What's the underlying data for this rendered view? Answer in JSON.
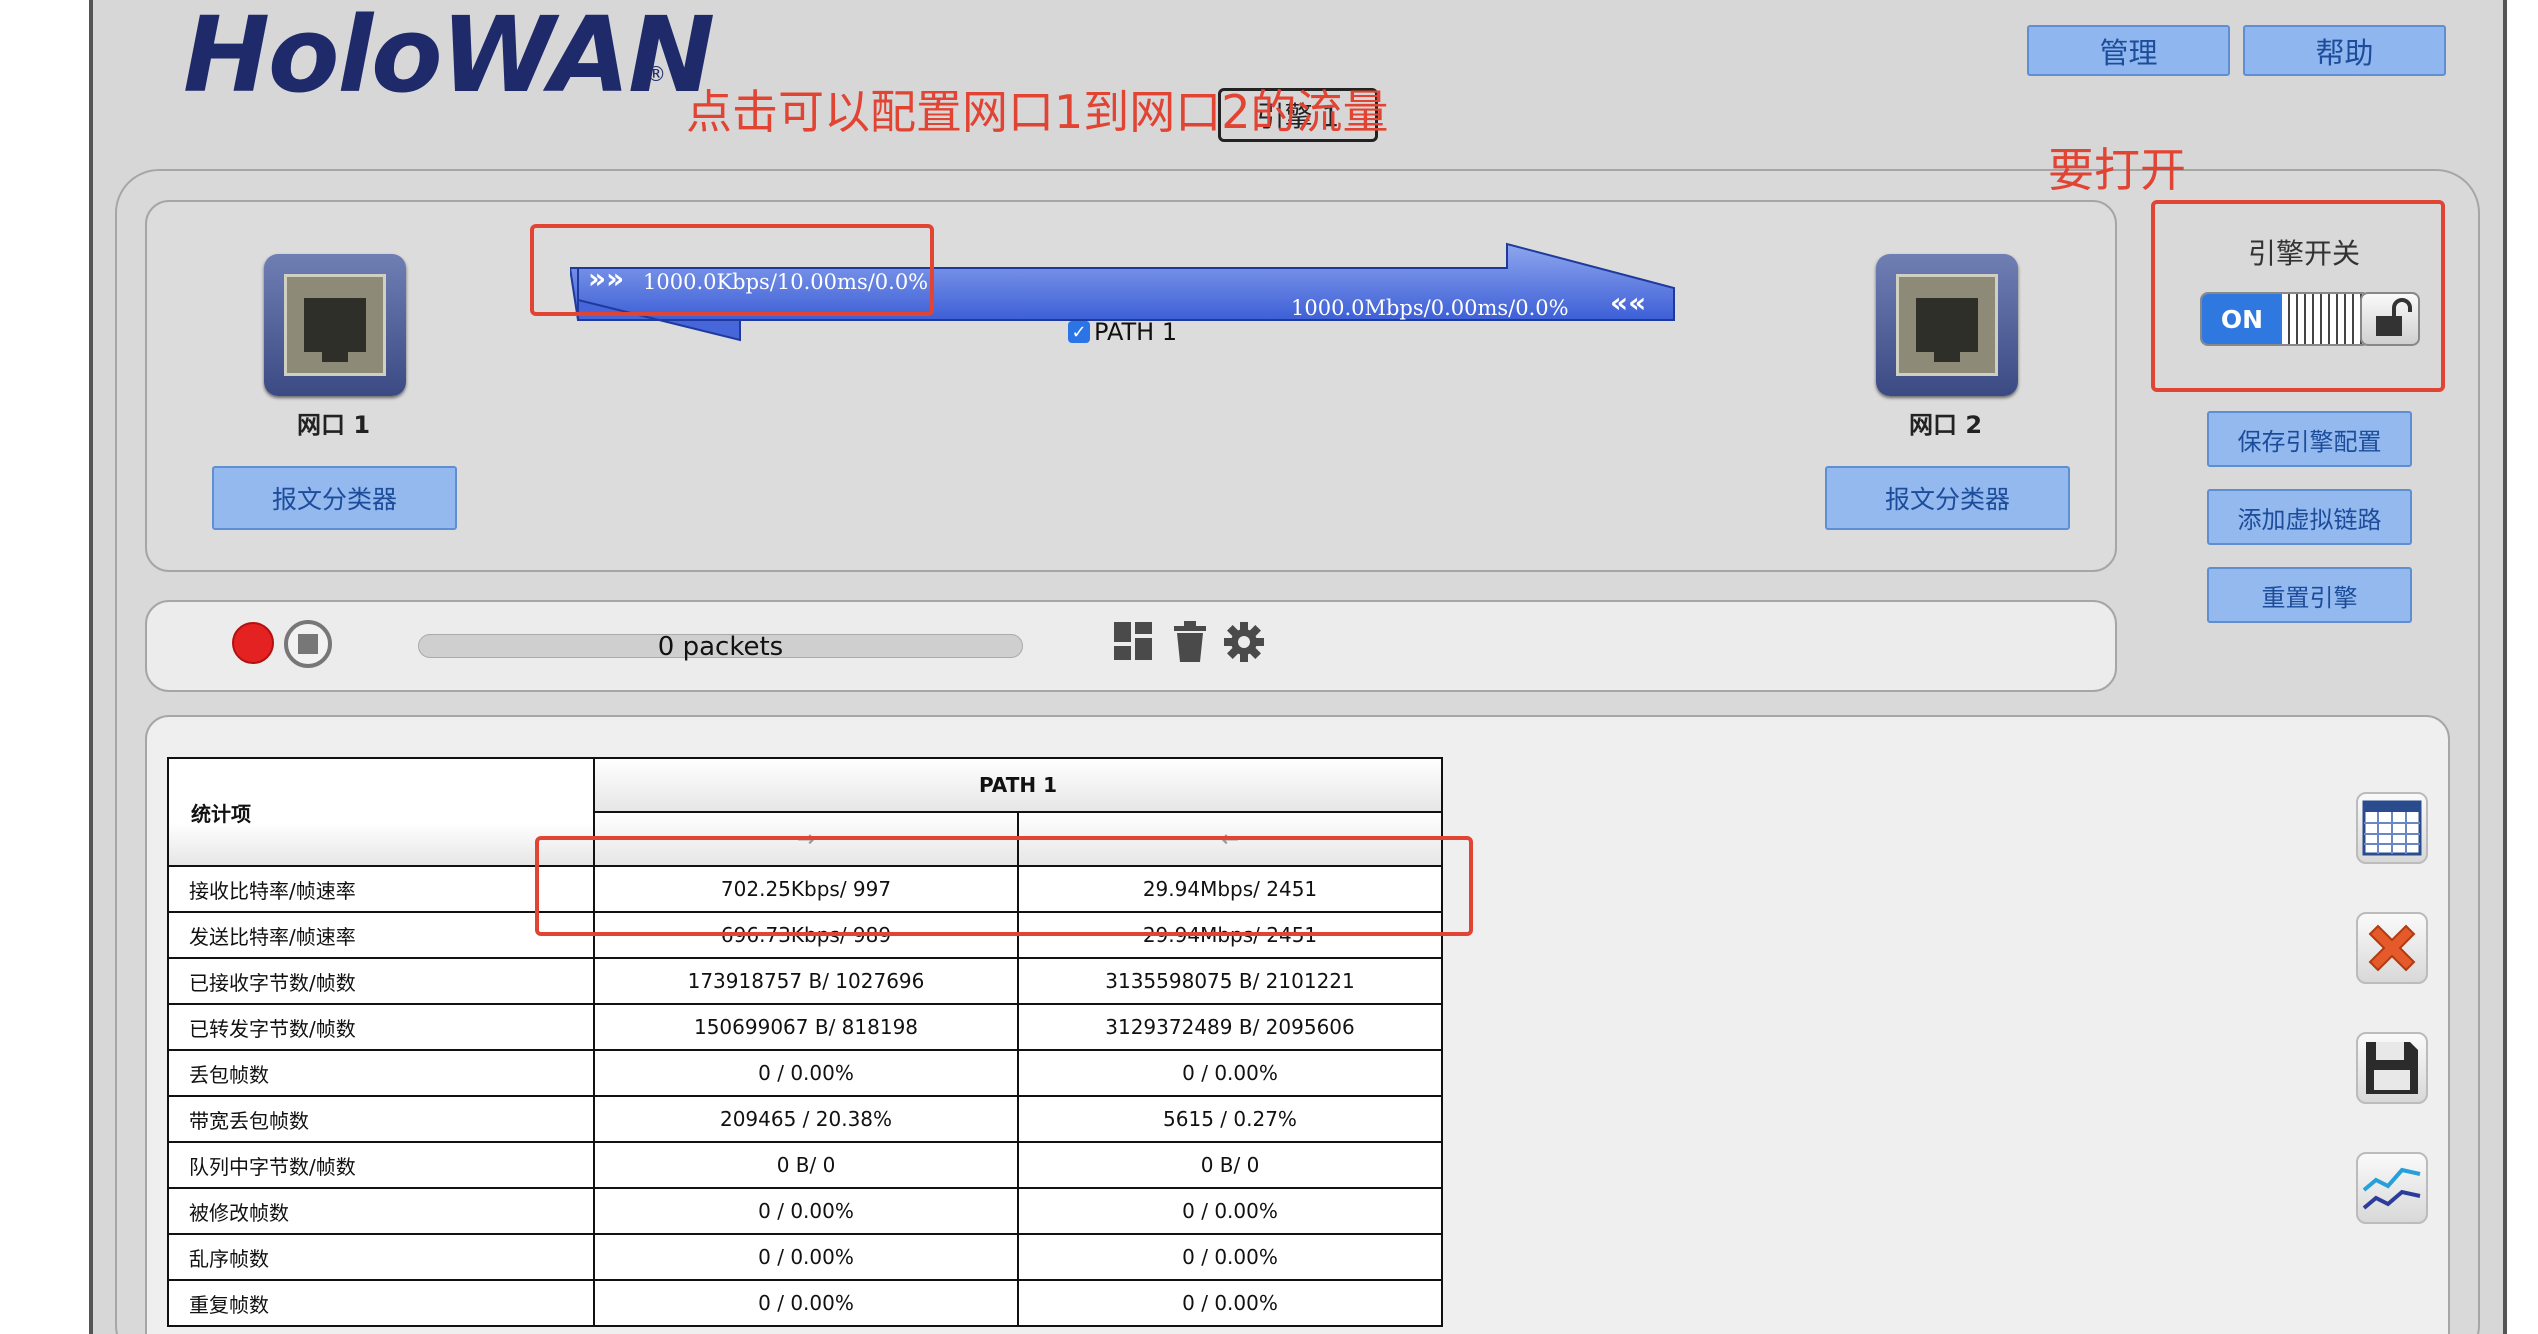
{
  "header": {
    "logo": "HoloWAN",
    "logo_mark": "®",
    "manage_label": "管理",
    "help_label": "帮助",
    "engine_tab": "引擎 1"
  },
  "annotations": {
    "configure_note": "点击可以配置网口1到网口2的流量",
    "turn_on_note": "要打开"
  },
  "ports": {
    "port1_label": "网口 1",
    "port2_label": "网口 2",
    "classifier_label": "报文分类器"
  },
  "path": {
    "forward_stats": "1000.0Kbps/10.00ms/0.0%",
    "reverse_stats": "1000.0Mbps/0.00ms/0.0%",
    "name": "PATH 1",
    "checked": true
  },
  "engine_controls": {
    "title": "引擎开关",
    "toggle_state": "ON",
    "save_config": "保存引擎配置",
    "add_link": "添加虚拟链路",
    "reset_engine": "重置引擎"
  },
  "capture": {
    "packets": "0 packets",
    "progress": 0
  },
  "stats_table": {
    "name_header": "统计项",
    "path_header": "PATH 1",
    "dir_forward": "→",
    "dir_reverse": "←",
    "rows": [
      {
        "label": "接收比特率/帧速率",
        "forward": "702.25Kbps/ 997",
        "reverse": "29.94Mbps/ 2451"
      },
      {
        "label": "发送比特率/帧速率",
        "forward": "696.73Kbps/ 989",
        "reverse": "29.94Mbps/ 2451"
      },
      {
        "label": "已接收字节数/帧数",
        "forward": "173918757 B/ 1027696",
        "reverse": "3135598075 B/ 2101221"
      },
      {
        "label": "已转发字节数/帧数",
        "forward": "150699067 B/ 818198",
        "reverse": "3129372489 B/ 2095606"
      },
      {
        "label": "丢包帧数",
        "forward": "0 / 0.00%",
        "reverse": "0 / 0.00%"
      },
      {
        "label": "带宽丢包帧数",
        "forward": "209465 / 20.38%",
        "reverse": "5615 / 0.27%"
      },
      {
        "label": "队列中字节数/帧数",
        "forward": "0 B/ 0",
        "reverse": "0 B/ 0"
      },
      {
        "label": "被修改帧数",
        "forward": "0 / 0.00%",
        "reverse": "0 / 0.00%"
      },
      {
        "label": "乱序帧数",
        "forward": "0 / 0.00%",
        "reverse": "0 / 0.00%"
      },
      {
        "label": "重复帧数",
        "forward": "0 / 0.00%",
        "reverse": "0 / 0.00%"
      }
    ]
  },
  "colors": {
    "annotation_red": "#e14433",
    "button_blue": "#93b9ef",
    "logo_navy": "#1f2a6b",
    "toggle_on": "#2f78e0"
  },
  "icons": [
    "record-icon",
    "stop-icon",
    "grid-icon",
    "trash-icon",
    "gear-icon",
    "calendar-table-icon",
    "delete-x-icon",
    "save-disk-icon",
    "line-chart-icon",
    "lock-open-icon",
    "ethernet-port-icon"
  ]
}
